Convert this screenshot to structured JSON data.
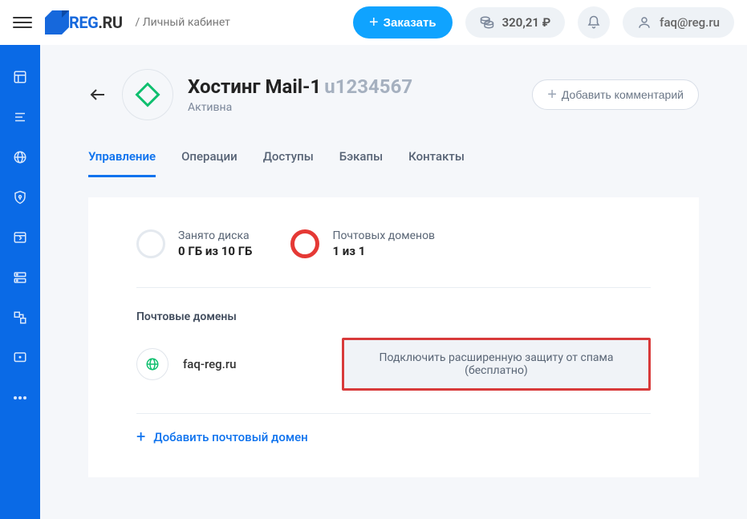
{
  "header": {
    "breadcrumb": "/ Личный кабинет",
    "order_btn": "Заказать",
    "balance": "320,21 ₽",
    "user_email": "faq@reg.ru"
  },
  "service": {
    "title": "Хостинг Mail-1",
    "id": "u1234567",
    "status": "Активна",
    "comment_btn": "Добавить комментарий"
  },
  "tabs": {
    "t0": "Управление",
    "t1": "Операции",
    "t2": "Доступы",
    "t3": "Бэкапы",
    "t4": "Контакты"
  },
  "stats": {
    "disk_label": "Занято диска",
    "disk_value": "0 ГБ из 10 ГБ",
    "domains_label": "Почтовых доменов",
    "domains_value": "1 из 1"
  },
  "mail": {
    "section_title": "Почтовые домены",
    "domain_name": "faq-reg.ru",
    "spam_btn": "Подключить расширенную защиту от спама (бесплатно)",
    "add_btn": "Добавить почтовый домен"
  }
}
